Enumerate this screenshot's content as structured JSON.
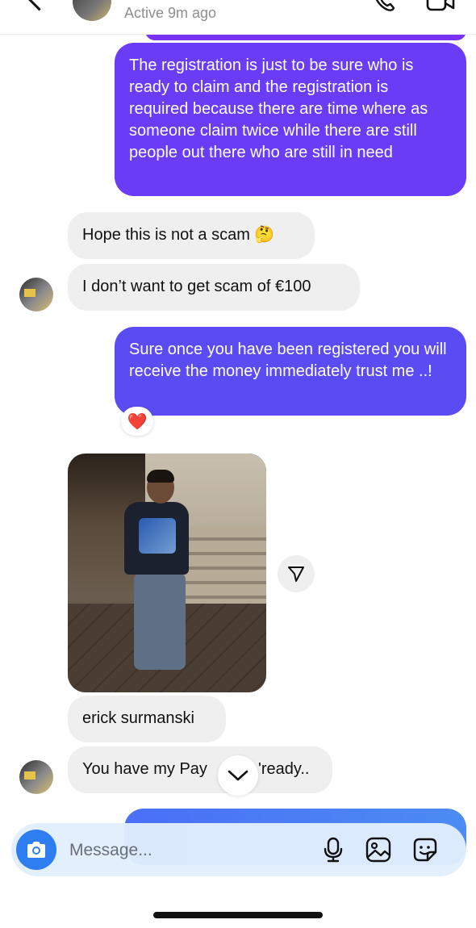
{
  "header": {
    "status": "Active 9m ago"
  },
  "messages": [
    {
      "side": "out",
      "text": "The registration is just to be sure who is ready to claim and the registration is required because there are time where as someone claim twice while there are still people out there who are still in need"
    },
    {
      "side": "in",
      "text": "Hope this is not a scam 🤔"
    },
    {
      "side": "in",
      "text": "I don’t want to get scam of €100"
    },
    {
      "side": "out",
      "text": "Sure once you have been registered you will receive the money immediately trust me ..!",
      "reaction": "❤️"
    },
    {
      "side": "in",
      "type": "photo"
    },
    {
      "side": "in",
      "text": "erick surmanski"
    },
    {
      "side": "in",
      "text_left": "You have my Pay",
      "text_right": "'ready.."
    }
  ],
  "composer": {
    "placeholder": "Message..."
  },
  "icons": {
    "back": "chevron-left-icon",
    "phone": "phone-icon",
    "video": "video-camera-icon",
    "share": "send-icon",
    "scroll": "chevron-down-icon",
    "camera": "camera-icon",
    "mic": "microphone-icon",
    "gallery": "image-icon",
    "sticker": "sticker-icon"
  },
  "colors": {
    "outgoing": "#6a3cf5",
    "incoming": "#efefef",
    "camera_button": "#2e7ef2"
  }
}
